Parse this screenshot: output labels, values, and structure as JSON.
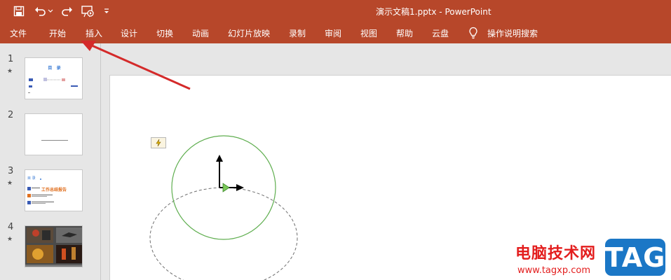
{
  "window": {
    "title": "演示文稿1.pptx  -  PowerPoint"
  },
  "colors": {
    "accent": "#b7472a",
    "arrow": "#d42a2a",
    "watermark_red": "#e31d1d",
    "watermark_blue": "#1b77c6"
  },
  "qat": {
    "icons": [
      "save-icon",
      "undo-icon",
      "redo-icon",
      "present-from-beginning-icon",
      "customize-qat-icon"
    ]
  },
  "ribbon": {
    "tabs": [
      {
        "label": "文件"
      },
      {
        "label": "开始"
      },
      {
        "label": "插入"
      },
      {
        "label": "设计"
      },
      {
        "label": "切换"
      },
      {
        "label": "动画"
      },
      {
        "label": "幻灯片放映"
      },
      {
        "label": "录制"
      },
      {
        "label": "审阅"
      },
      {
        "label": "视图"
      },
      {
        "label": "帮助"
      },
      {
        "label": "云盘"
      }
    ],
    "tell_me": "操作说明搜索"
  },
  "slides": [
    {
      "number": "1",
      "star": "★",
      "toc_title": "目   录"
    },
    {
      "number": "2",
      "star": ""
    },
    {
      "number": "3",
      "star": "★",
      "label": "目 录",
      "headline": "工作总结报告"
    },
    {
      "number": "4",
      "star": "★"
    }
  ],
  "watermark": {
    "site_name": "电脑技术网",
    "url": "www.tagxp.com",
    "badge": "TAG"
  }
}
